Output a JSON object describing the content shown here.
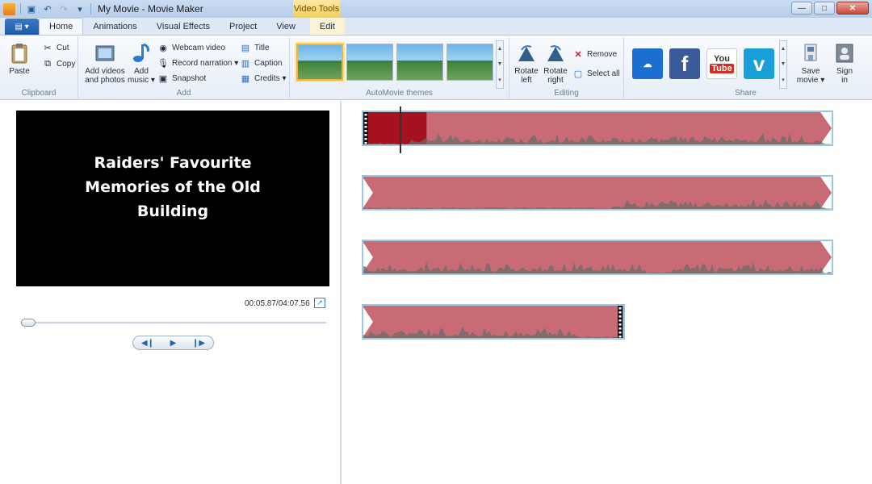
{
  "window": {
    "title": "My Movie - Movie Maker",
    "context_tab_group": "Video Tools"
  },
  "tabs": {
    "file_menu": "▤ ▾",
    "items": [
      {
        "label": "Home",
        "active": true
      },
      {
        "label": "Animations"
      },
      {
        "label": "Visual Effects"
      },
      {
        "label": "Project"
      },
      {
        "label": "View"
      },
      {
        "label": "Edit"
      }
    ]
  },
  "ribbon": {
    "clipboard": {
      "label": "Clipboard",
      "paste": "Paste",
      "cut": "Cut",
      "copy": "Copy"
    },
    "add": {
      "label": "Add",
      "add_videos": "Add videos\nand photos",
      "add_music": "Add\nmusic ▾",
      "webcam_video": "Webcam video",
      "record_narration": "Record narration ▾",
      "snapshot": "Snapshot",
      "title": "Title",
      "caption": "Caption",
      "credits": "Credits ▾"
    },
    "themes": {
      "label": "AutoMovie themes"
    },
    "editing": {
      "label": "Editing",
      "rotate_left": "Rotate\nleft",
      "rotate_right": "Rotate\nright",
      "remove": "Remove",
      "select_all": "Select all"
    },
    "share": {
      "label": "Share",
      "services": [
        "onedrive-icon",
        "facebook-icon",
        "youtube-icon",
        "vimeo-icon"
      ],
      "save_movie": "Save\nmovie ▾",
      "sign_in": "Sign\nin"
    }
  },
  "preview": {
    "text": "Raiders' Favourite Memories of the Old Building",
    "timecode": "00:05.87/04:07.56",
    "progress": 0.024
  },
  "timeline": {
    "clips": [
      {
        "id": 1,
        "selected_portion": 0.135,
        "playhead": 0.08
      },
      {
        "id": 2
      },
      {
        "id": 3
      },
      {
        "id": 4
      }
    ],
    "colors": {
      "clip": "#c86b74",
      "selected": "#a5111f",
      "border": "#9cc8e3",
      "wave": "#6b6b6b"
    }
  }
}
